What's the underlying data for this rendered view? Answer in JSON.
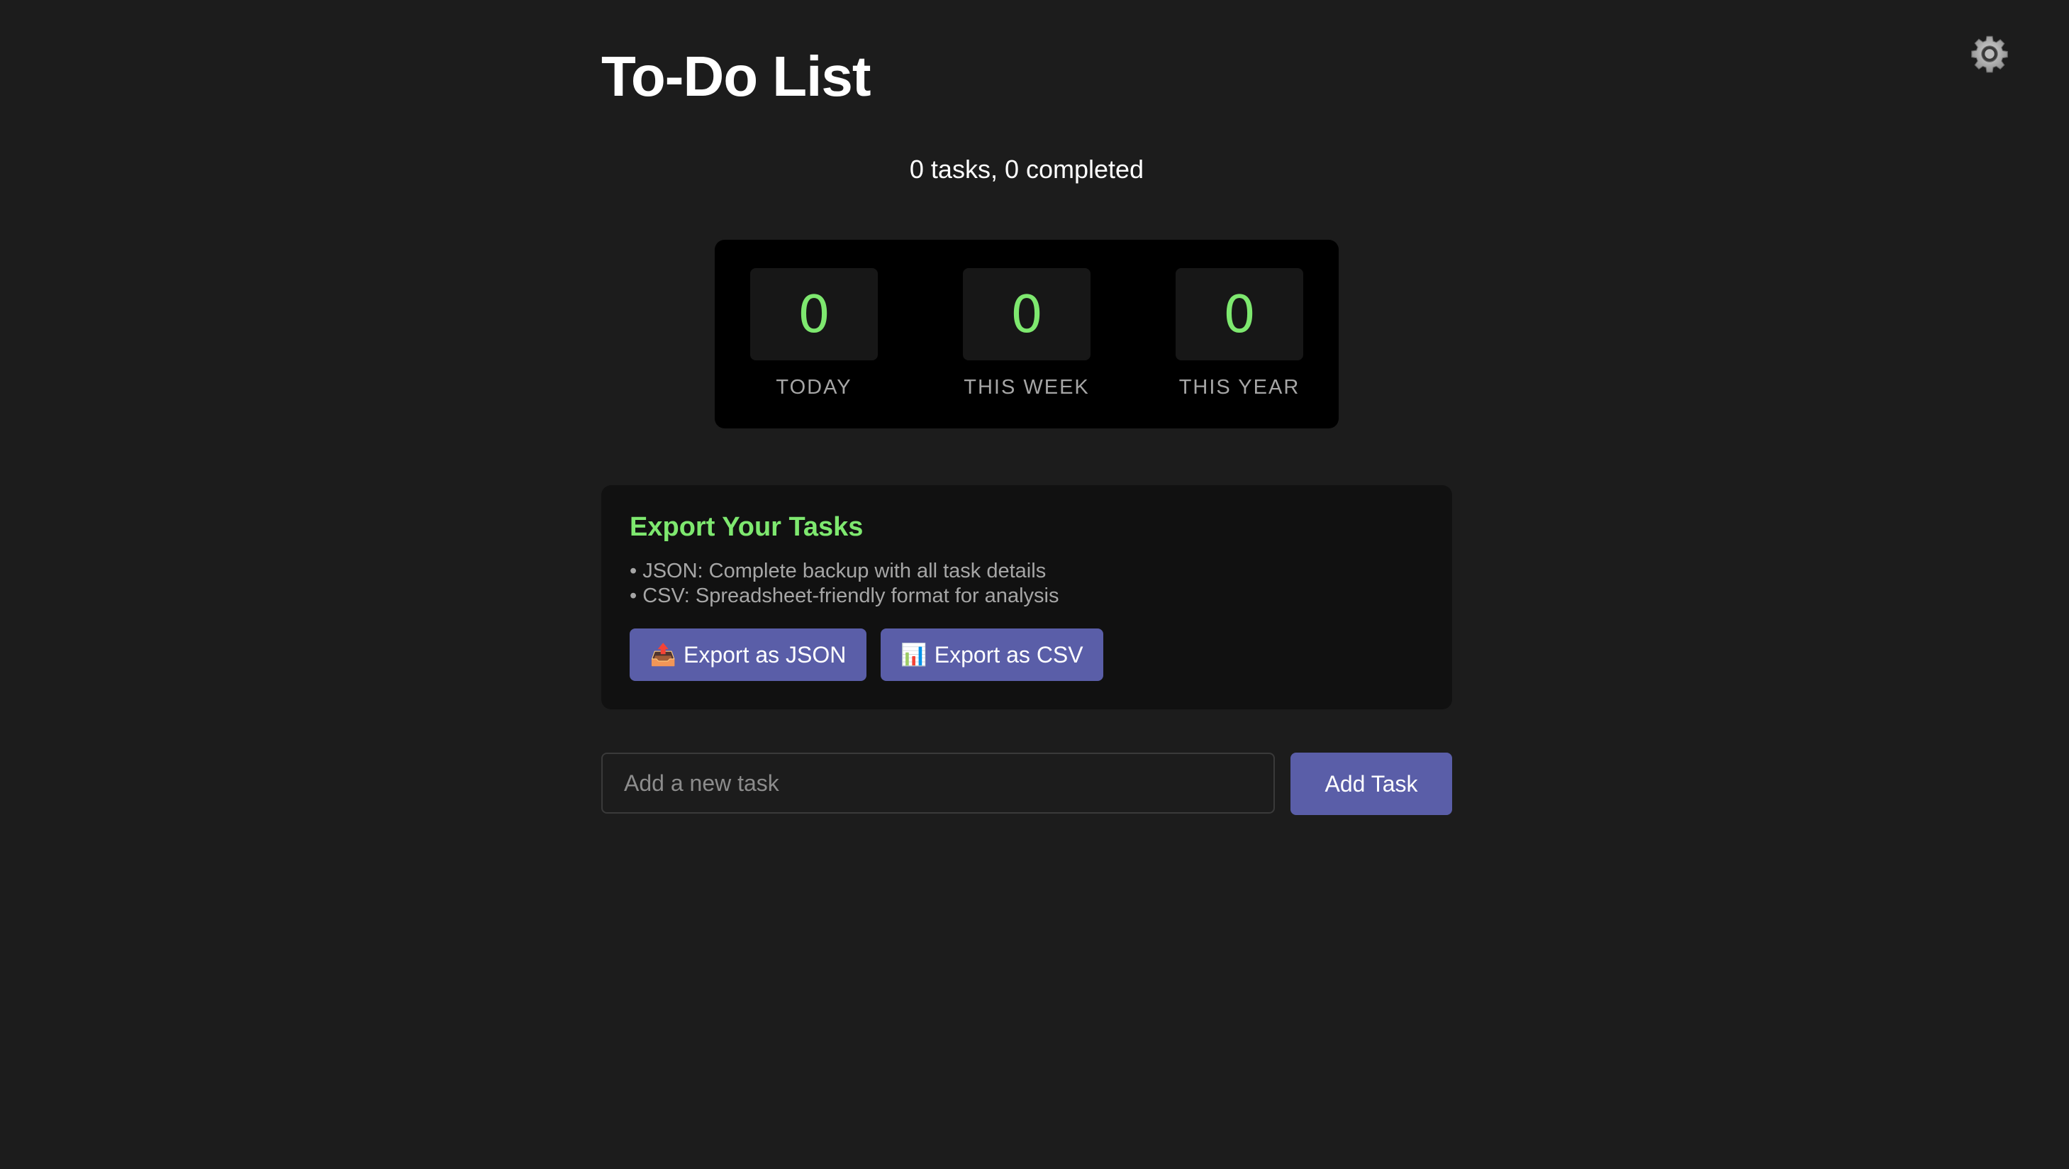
{
  "header": {
    "title": "To-Do List",
    "settings_icon": "gear-icon"
  },
  "summary": {
    "text": "0 tasks, 0 completed"
  },
  "stats": [
    {
      "value": "0",
      "label": "TODAY"
    },
    {
      "value": "0",
      "label": "THIS WEEK"
    },
    {
      "value": "0",
      "label": "THIS YEAR"
    }
  ],
  "export": {
    "heading": "Export Your Tasks",
    "notes": [
      "JSON: Complete backup with all task details",
      "CSV: Spreadsheet-friendly format for analysis"
    ],
    "json_button": {
      "icon": "📤",
      "icon_name": "outbox-tray-icon",
      "label": "Export as JSON"
    },
    "csv_button": {
      "icon": "📊",
      "icon_name": "bar-chart-icon",
      "label": "Export as CSV"
    }
  },
  "new_task": {
    "placeholder": "Add a new task",
    "value": "",
    "button_label": "Add Task"
  },
  "colors": {
    "background": "#1c1c1c",
    "accent_green": "#7ee86f",
    "button": "#5a5ea8",
    "panel": "#000000",
    "card": "#111111"
  }
}
